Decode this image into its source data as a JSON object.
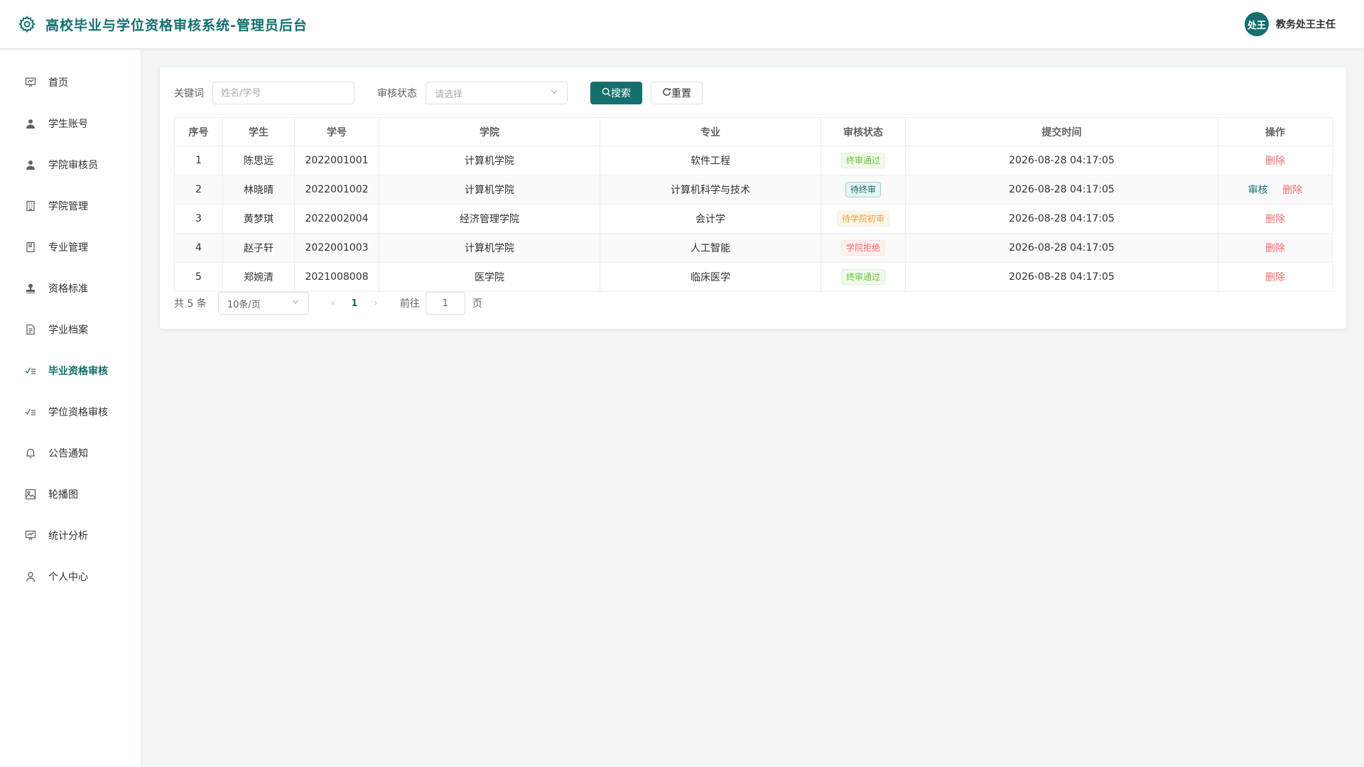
{
  "header": {
    "title": "高校毕业与学位资格审核系统-管理员后台",
    "avatar_text": "处王",
    "username": "教务处王主任"
  },
  "sidebar": {
    "items": [
      {
        "label": "首页",
        "icon": "dashboard-icon"
      },
      {
        "label": "学生账号",
        "icon": "user-icon"
      },
      {
        "label": "学院审核员",
        "icon": "user-icon"
      },
      {
        "label": "学院管理",
        "icon": "building-icon"
      },
      {
        "label": "专业管理",
        "icon": "book-icon"
      },
      {
        "label": "资格标准",
        "icon": "stamp-icon"
      },
      {
        "label": "学业档案",
        "icon": "document-icon"
      },
      {
        "label": "毕业资格审核",
        "icon": "checklist-icon",
        "active": true
      },
      {
        "label": "学位资格审核",
        "icon": "checklist-icon"
      },
      {
        "label": "公告通知",
        "icon": "bell-icon"
      },
      {
        "label": "轮播图",
        "icon": "picture-icon"
      },
      {
        "label": "统计分析",
        "icon": "chart-icon"
      },
      {
        "label": "个人中心",
        "icon": "person-icon"
      }
    ]
  },
  "filter": {
    "keyword_label": "关键词",
    "keyword_placeholder": "姓名/学号",
    "keyword_value": "",
    "status_label": "审核状态",
    "status_placeholder": "请选择",
    "search_label": "搜索",
    "reset_label": "重置"
  },
  "table": {
    "columns": [
      "序号",
      "学生",
      "学号",
      "学院",
      "专业",
      "审核状态",
      "提交时间",
      "操作"
    ],
    "rows": [
      {
        "index": "1",
        "name": "陈思远",
        "id": "2022001001",
        "college": "计算机学院",
        "major": "软件工程",
        "status": "终审通过",
        "status_type": "success",
        "time": "2026-08-28 04:17:05",
        "actions": [
          "删除"
        ]
      },
      {
        "index": "2",
        "name": "林晓晴",
        "id": "2022001002",
        "college": "计算机学院",
        "major": "计算机科学与技术",
        "status": "待终审",
        "status_type": "primary",
        "time": "2026-08-28 04:17:05",
        "actions": [
          "审核",
          "删除"
        ]
      },
      {
        "index": "3",
        "name": "黄梦琪",
        "id": "2022002004",
        "college": "经济管理学院",
        "major": "会计学",
        "status": "待学院初审",
        "status_type": "warning",
        "time": "2026-08-28 04:17:05",
        "actions": [
          "删除"
        ]
      },
      {
        "index": "4",
        "name": "赵子轩",
        "id": "2022001003",
        "college": "计算机学院",
        "major": "人工智能",
        "status": "学院拒绝",
        "status_type": "danger",
        "time": "2026-08-28 04:17:05",
        "actions": [
          "删除"
        ]
      },
      {
        "index": "5",
        "name": "郑婉清",
        "id": "2021008008",
        "college": "医学院",
        "major": "临床医学",
        "status": "终审通过",
        "status_type": "success",
        "time": "2026-08-28 04:17:05",
        "actions": [
          "删除"
        ]
      }
    ]
  },
  "pagination": {
    "total_text": "共 5 条",
    "page_size": "10条/页",
    "current_page": "1",
    "goto_label": "前往",
    "goto_value": "1",
    "page_unit": "页"
  },
  "colors": {
    "accent": "#13706e",
    "success": "#67c23a",
    "warning": "#e6a23c",
    "danger": "#f56c6c"
  }
}
